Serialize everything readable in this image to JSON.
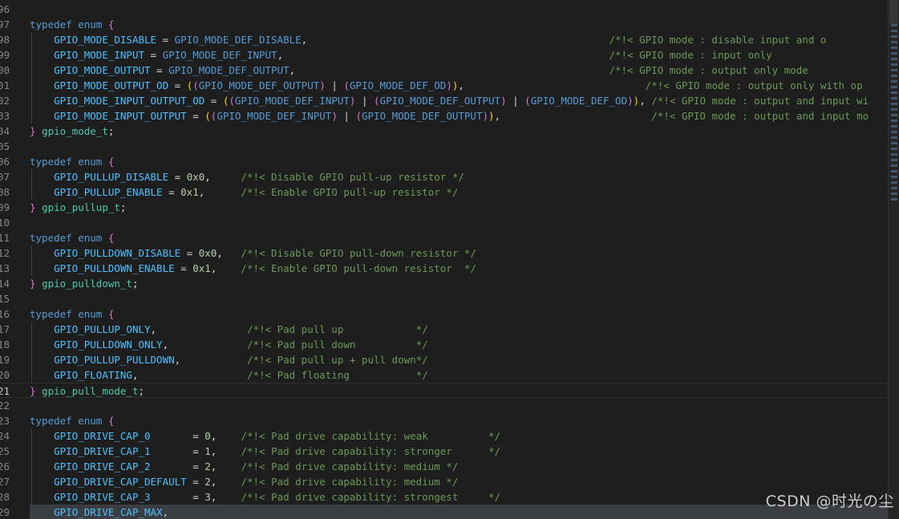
{
  "editor": {
    "lines": [
      {
        "n": "96",
        "t": []
      },
      {
        "n": "97",
        "t": [
          [
            "kw",
            "typedef enum "
          ],
          [
            "p1",
            "{"
          ]
        ]
      },
      {
        "n": "98",
        "t": [
          [
            "op",
            "    "
          ],
          [
            "en",
            "GPIO_MODE_DISABLE"
          ],
          [
            "op",
            " = "
          ],
          [
            "mac",
            "GPIO_MODE_DEF_DISABLE"
          ],
          [
            "op",
            ",                                                  "
          ],
          [
            "cm",
            "/*!< GPIO mode : disable input and o"
          ]
        ]
      },
      {
        "n": "99",
        "t": [
          [
            "op",
            "    "
          ],
          [
            "en",
            "GPIO_MODE_INPUT"
          ],
          [
            "op",
            " = "
          ],
          [
            "mac",
            "GPIO_MODE_DEF_INPUT"
          ],
          [
            "op",
            ",                                                      "
          ],
          [
            "cm",
            "/*!< GPIO mode : input only"
          ]
        ]
      },
      {
        "n": "00",
        "t": [
          [
            "op",
            "    "
          ],
          [
            "en",
            "GPIO_MODE_OUTPUT"
          ],
          [
            "op",
            " = "
          ],
          [
            "mac",
            "GPIO_MODE_DEF_OUTPUT"
          ],
          [
            "op",
            ",                                                    "
          ],
          [
            "cm",
            "/*!< GPIO mode : output only mode"
          ]
        ]
      },
      {
        "n": "01",
        "t": [
          [
            "op",
            "    "
          ],
          [
            "en",
            "GPIO_MODE_OUTPUT_OD"
          ],
          [
            "op",
            " = "
          ],
          [
            "p2",
            "("
          ],
          [
            "p1",
            "("
          ],
          [
            "mac",
            "GPIO_MODE_DEF_OUTPUT"
          ],
          [
            "p1",
            ")"
          ],
          [
            "op",
            " | "
          ],
          [
            "p1",
            "("
          ],
          [
            "mac",
            "GPIO_MODE_DEF_OD"
          ],
          [
            "p1",
            ")"
          ],
          [
            "p2",
            ")"
          ],
          [
            "op",
            ",                              "
          ],
          [
            "cm",
            "/*!< GPIO mode : output only with op"
          ]
        ]
      },
      {
        "n": "02",
        "t": [
          [
            "op",
            "    "
          ],
          [
            "en",
            "GPIO_MODE_INPUT_OUTPUT_OD"
          ],
          [
            "op",
            " = "
          ],
          [
            "p2",
            "("
          ],
          [
            "p1",
            "("
          ],
          [
            "mac",
            "GPIO_MODE_DEF_INPUT"
          ],
          [
            "p1",
            ")"
          ],
          [
            "op",
            " | "
          ],
          [
            "p1",
            "("
          ],
          [
            "mac",
            "GPIO_MODE_DEF_OUTPUT"
          ],
          [
            "p1",
            ")"
          ],
          [
            "op",
            " | "
          ],
          [
            "p1",
            "("
          ],
          [
            "mac",
            "GPIO_MODE_DEF_OD"
          ],
          [
            "p1",
            ")"
          ],
          [
            "p2",
            ")"
          ],
          [
            "op",
            ", "
          ],
          [
            "cm",
            "/*!< GPIO mode : output and input wi"
          ]
        ]
      },
      {
        "n": "03",
        "t": [
          [
            "op",
            "    "
          ],
          [
            "en",
            "GPIO_MODE_INPUT_OUTPUT"
          ],
          [
            "op",
            " = "
          ],
          [
            "p2",
            "("
          ],
          [
            "p1",
            "("
          ],
          [
            "mac",
            "GPIO_MODE_DEF_INPUT"
          ],
          [
            "p1",
            ")"
          ],
          [
            "op",
            " | "
          ],
          [
            "p1",
            "("
          ],
          [
            "mac",
            "GPIO_MODE_DEF_OUTPUT"
          ],
          [
            "p1",
            ")"
          ],
          [
            "p2",
            ")"
          ],
          [
            "op",
            ",                         "
          ],
          [
            "cm",
            "/*!< GPIO mode : output and input mo"
          ]
        ]
      },
      {
        "n": "04",
        "t": [
          [
            "p1",
            "}"
          ],
          [
            "op",
            " "
          ],
          [
            "typ",
            "gpio_mode_t"
          ],
          [
            "op",
            ";"
          ]
        ]
      },
      {
        "n": "05",
        "t": []
      },
      {
        "n": "06",
        "t": [
          [
            "kw",
            "typedef enum "
          ],
          [
            "p1",
            "{"
          ]
        ]
      },
      {
        "n": "07",
        "t": [
          [
            "op",
            "    "
          ],
          [
            "en",
            "GPIO_PULLUP_DISABLE"
          ],
          [
            "op",
            " = "
          ],
          [
            "num",
            "0x0"
          ],
          [
            "op",
            ",     "
          ],
          [
            "cm",
            "/*!< Disable GPIO pull-up resistor */"
          ]
        ]
      },
      {
        "n": "08",
        "t": [
          [
            "op",
            "    "
          ],
          [
            "en",
            "GPIO_PULLUP_ENABLE"
          ],
          [
            "op",
            " = "
          ],
          [
            "num",
            "0x1"
          ],
          [
            "op",
            ",      "
          ],
          [
            "cm",
            "/*!< Enable GPIO pull-up resistor */"
          ]
        ]
      },
      {
        "n": "09",
        "t": [
          [
            "p1",
            "}"
          ],
          [
            "op",
            " "
          ],
          [
            "typ",
            "gpio_pullup_t"
          ],
          [
            "op",
            ";"
          ]
        ]
      },
      {
        "n": "10",
        "t": []
      },
      {
        "n": "11",
        "t": [
          [
            "kw",
            "typedef enum "
          ],
          [
            "p1",
            "{"
          ]
        ]
      },
      {
        "n": "12",
        "t": [
          [
            "op",
            "    "
          ],
          [
            "en",
            "GPIO_PULLDOWN_DISABLE"
          ],
          [
            "op",
            " = "
          ],
          [
            "num",
            "0x0"
          ],
          [
            "op",
            ",   "
          ],
          [
            "cm",
            "/*!< Disable GPIO pull-down resistor */"
          ]
        ]
      },
      {
        "n": "13",
        "t": [
          [
            "op",
            "    "
          ],
          [
            "en",
            "GPIO_PULLDOWN_ENABLE"
          ],
          [
            "op",
            " = "
          ],
          [
            "num",
            "0x1"
          ],
          [
            "op",
            ",    "
          ],
          [
            "cm",
            "/*!< Enable GPIO pull-down resistor  */"
          ]
        ]
      },
      {
        "n": "14",
        "t": [
          [
            "p1",
            "}"
          ],
          [
            "op",
            " "
          ],
          [
            "typ",
            "gpio_pulldown_t"
          ],
          [
            "op",
            ";"
          ]
        ]
      },
      {
        "n": "15",
        "t": []
      },
      {
        "n": "16",
        "t": [
          [
            "kw",
            "typedef enum "
          ],
          [
            "p1",
            "{"
          ]
        ]
      },
      {
        "n": "17",
        "t": [
          [
            "op",
            "    "
          ],
          [
            "en",
            "GPIO_PULLUP_ONLY"
          ],
          [
            "op",
            ",               "
          ],
          [
            "cm",
            "/*!< Pad pull up            */"
          ]
        ]
      },
      {
        "n": "18",
        "t": [
          [
            "op",
            "    "
          ],
          [
            "en",
            "GPIO_PULLDOWN_ONLY"
          ],
          [
            "op",
            ",             "
          ],
          [
            "cm",
            "/*!< Pad pull down          */"
          ]
        ]
      },
      {
        "n": "19",
        "t": [
          [
            "op",
            "    "
          ],
          [
            "en",
            "GPIO_PULLUP_PULLDOWN"
          ],
          [
            "op",
            ",           "
          ],
          [
            "cm",
            "/*!< Pad pull up + pull down*/"
          ]
        ]
      },
      {
        "n": "20",
        "t": [
          [
            "op",
            "    "
          ],
          [
            "en",
            "GPIO_FLOATING"
          ],
          [
            "op",
            ",                  "
          ],
          [
            "cm",
            "/*!< Pad floating           */"
          ]
        ]
      },
      {
        "n": "21",
        "t": [
          [
            "p1",
            "}"
          ],
          [
            "op",
            " "
          ],
          [
            "typ",
            "gpio_pull_mode_t"
          ],
          [
            "op",
            ";"
          ]
        ],
        "current": true
      },
      {
        "n": "22",
        "t": []
      },
      {
        "n": "23",
        "t": [
          [
            "kw",
            "typedef enum "
          ],
          [
            "p1",
            "{"
          ]
        ]
      },
      {
        "n": "24",
        "t": [
          [
            "op",
            "    "
          ],
          [
            "en",
            "GPIO_DRIVE_CAP_0"
          ],
          [
            "op",
            "       = "
          ],
          [
            "num",
            "0"
          ],
          [
            "op",
            ",    "
          ],
          [
            "cm",
            "/*!< Pad drive capability: weak          */"
          ]
        ]
      },
      {
        "n": "25",
        "t": [
          [
            "op",
            "    "
          ],
          [
            "en",
            "GPIO_DRIVE_CAP_1"
          ],
          [
            "op",
            "       = "
          ],
          [
            "num",
            "1"
          ],
          [
            "op",
            ",    "
          ],
          [
            "cm",
            "/*!< Pad drive capability: stronger      */"
          ]
        ]
      },
      {
        "n": "26",
        "t": [
          [
            "op",
            "    "
          ],
          [
            "en",
            "GPIO_DRIVE_CAP_2"
          ],
          [
            "op",
            "       = "
          ],
          [
            "num",
            "2"
          ],
          [
            "op",
            ",    "
          ],
          [
            "cm",
            "/*!< Pad drive capability: medium */"
          ]
        ]
      },
      {
        "n": "27",
        "t": [
          [
            "op",
            "    "
          ],
          [
            "en",
            "GPIO_DRIVE_CAP_DEFAULT"
          ],
          [
            "op",
            " = "
          ],
          [
            "num",
            "2"
          ],
          [
            "op",
            ",    "
          ],
          [
            "cm",
            "/*!< Pad drive capability: medium */"
          ]
        ]
      },
      {
        "n": "28",
        "t": [
          [
            "op",
            "    "
          ],
          [
            "en",
            "GPIO_DRIVE_CAP_3"
          ],
          [
            "op",
            "       = "
          ],
          [
            "num",
            "3"
          ],
          [
            "op",
            ",    "
          ],
          [
            "cm",
            "/*!< Pad drive capability: strongest     */"
          ]
        ]
      },
      {
        "n": "29",
        "t": [
          [
            "op",
            "    "
          ],
          [
            "en",
            "GPIO_DRIVE_CAP_MAX"
          ],
          [
            "op",
            ","
          ]
        ],
        "selected": true
      }
    ]
  },
  "watermark": "CSDN @时光の尘"
}
